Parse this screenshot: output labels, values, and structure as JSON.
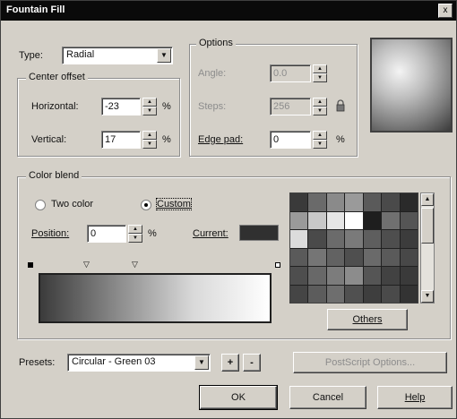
{
  "window": {
    "title": "Fountain Fill",
    "close_glyph": "x"
  },
  "type": {
    "label": "Type:",
    "value": "Radial"
  },
  "center_offset": {
    "title": "Center offset",
    "horizontal_label": "Horizontal:",
    "horizontal_value": "-23",
    "horizontal_unit": "%",
    "vertical_label": "Vertical:",
    "vertical_value": "17",
    "vertical_unit": "%"
  },
  "options": {
    "title": "Options",
    "angle_label": "Angle:",
    "angle_value": "0.0",
    "steps_label": "Steps:",
    "steps_value": "256",
    "edge_pad_label": "Edge pad:",
    "edge_pad_value": "0",
    "edge_pad_unit": "%"
  },
  "color_blend": {
    "title": "Color blend",
    "two_color_label": "Two color",
    "custom_label": "Custom",
    "selected": "Custom",
    "position_label": "Position:",
    "position_value": "0",
    "position_unit": "%",
    "current_label": "Current:",
    "current_color": "#303030",
    "blend_colors": [
      "#3b3b3b",
      "#8a8a8a",
      "#d9d9d9",
      "#ffffff"
    ],
    "palette_colors": [
      "#3a3a3a",
      "#6a6a6a",
      "#8a8a8a",
      "#9a9a9a",
      "#5a5a5a",
      "#4a4a4a",
      "#2a2a2a",
      "#9a9a9a",
      "#c8c8c8",
      "#e6e6e6",
      "#ffffff",
      "#1e1e1e",
      "#707070",
      "#555555",
      "#dcdcdc",
      "#4a4a4a",
      "#6b6b6b",
      "#7a7a7a",
      "#5e5e5e",
      "#4e4e4e",
      "#3c3c3c",
      "#5a5a5a",
      "#757575",
      "#626262",
      "#4f4f4f",
      "#6a6a6a",
      "#5a5a5a",
      "#484848",
      "#4e4e4e",
      "#686868",
      "#7c7c7c",
      "#8c8c8c",
      "#555555",
      "#424242",
      "#3a3a3a",
      "#454545",
      "#5c5c5c",
      "#6e6e6e",
      "#505050",
      "#3e3e3e",
      "#4a4a4a",
      "#333333"
    ],
    "others_label": "Others"
  },
  "presets": {
    "label": "Presets:",
    "value": "Circular - Green 03",
    "add_symbol": "+",
    "remove_symbol": "-",
    "postscript_label": "PostScript Options..."
  },
  "buttons": {
    "ok": "OK",
    "cancel": "Cancel",
    "help": "Help"
  }
}
